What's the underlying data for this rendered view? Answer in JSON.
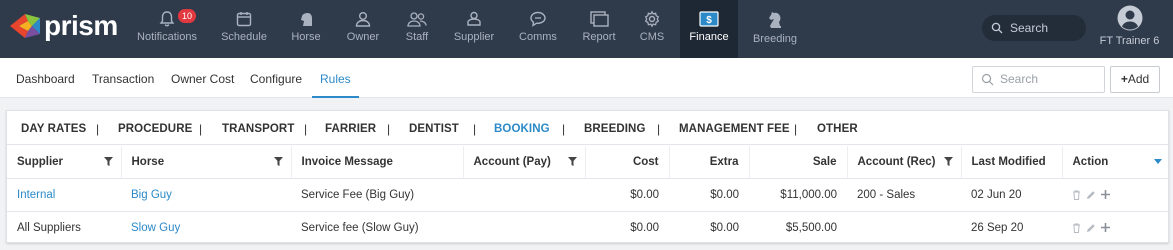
{
  "brand": {
    "name": "prism"
  },
  "topnav": {
    "items": [
      {
        "label": "Notifications",
        "icon": "bell-icon",
        "badge": "10"
      },
      {
        "label": "Schedule",
        "icon": "calendar-icon"
      },
      {
        "label": "Horse",
        "icon": "horse-head-icon"
      },
      {
        "label": "Owner",
        "icon": "owner-icon"
      },
      {
        "label": "Staff",
        "icon": "staff-icon"
      },
      {
        "label": "Supplier",
        "icon": "supplier-icon"
      },
      {
        "label": "Comms",
        "icon": "chat-icon"
      },
      {
        "label": "Report",
        "icon": "report-icon"
      },
      {
        "label": "CMS",
        "icon": "gear-icon"
      },
      {
        "label": "Finance",
        "icon": "dollar-icon",
        "active": true
      },
      {
        "label": "Breeding",
        "icon": "chess-knight-icon"
      }
    ],
    "search_placeholder": "Search",
    "user_name": "FT Trainer 6"
  },
  "subnav": {
    "tabs": [
      "Dashboard",
      "Transaction",
      "Owner Cost",
      "Configure",
      "Rules"
    ],
    "active": "Rules",
    "search_placeholder": "Search",
    "add_label": "Add"
  },
  "rules": {
    "tabs": [
      "DAY RATES",
      "PROCEDURE",
      "TRANSPORT",
      "FARRIER",
      "DENTIST",
      "BOOKING",
      "BREEDING",
      "MANAGEMENT FEE",
      "OTHER"
    ],
    "active": "BOOKING",
    "separator": "|"
  },
  "table": {
    "columns": [
      "Supplier",
      "Horse",
      "Invoice Message",
      "Account (Pay)",
      "Cost",
      "Extra",
      "Sale",
      "Account (Rec)",
      "Last Modified",
      "Action"
    ],
    "rows": [
      {
        "supplier": "Internal",
        "horse": "Big Guy",
        "invoice_message": "Service Fee (Big Guy)",
        "account_pay": "",
        "cost": "$0.00",
        "extra": "$0.00",
        "sale": "$11,000.00",
        "account_rec": "200 - Sales",
        "last_modified": "02 Jun 20"
      },
      {
        "supplier": "All Suppliers",
        "horse": "Slow Guy",
        "invoice_message": "Service fee (Slow Guy)",
        "account_pay": "",
        "cost": "$0.00",
        "extra": "$0.00",
        "sale": "$5,500.00",
        "account_rec": "",
        "last_modified": "26 Sep 20"
      }
    ]
  },
  "colors": {
    "topbar": "#2f3a4b",
    "accent": "#2c8ac8",
    "badge": "#e2383f"
  }
}
